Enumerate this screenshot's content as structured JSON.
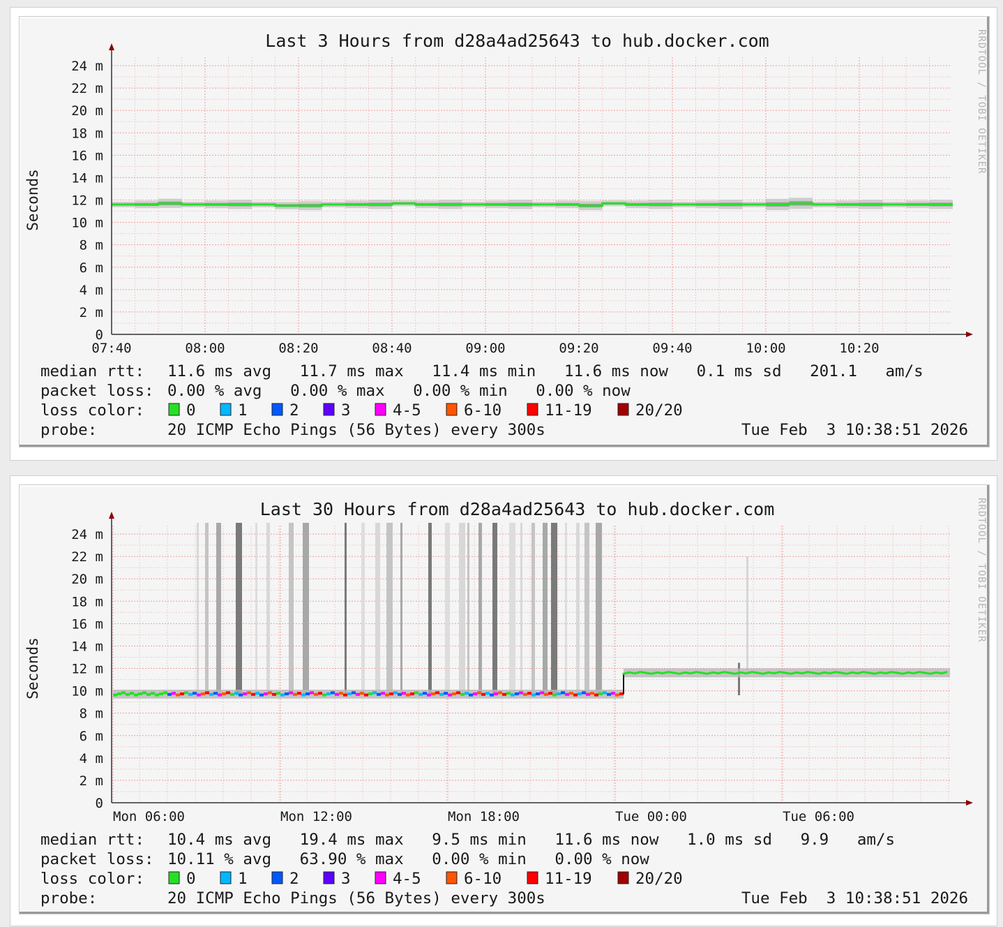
{
  "graphs": [
    {
      "title": "Last 3 Hours from d28a4ad25643 to hub.docker.com",
      "ylabel": "Seconds",
      "vertical_credit": "RRDTOOL / TOBI OETIKER",
      "stats": {
        "median_label": "median rtt:",
        "median_line": "11.6 ms avg   11.7 ms max   11.4 ms min   11.6 ms now   0.1 ms sd   201.1   am/s",
        "loss_label": "packet loss:",
        "loss_line": "0.00 % avg   0.00 % max   0.00 % min   0.00 % now",
        "color_label": "loss color:",
        "probe_label": "probe:",
        "probe_line": "20 ICMP Echo Pings (56 Bytes) every 300s",
        "timestamp": "Tue Feb  3 10:38:51 2026"
      }
    },
    {
      "title": "Last 30 Hours from d28a4ad25643 to hub.docker.com",
      "ylabel": "Seconds",
      "vertical_credit": "RRDTOOL / TOBI OETIKER",
      "stats": {
        "median_label": "median rtt:",
        "median_line": "10.4 ms avg   19.4 ms max   9.5 ms min   11.6 ms now   1.0 ms sd   9.9   am/s",
        "loss_label": "packet loss:",
        "loss_line": "10.11 % avg   63.90 % max   0.00 % min   0.00 % now",
        "color_label": "loss color:",
        "probe_label": "probe:",
        "probe_line": "20 ICMP Echo Pings (56 Bytes) every 300s",
        "timestamp": "Tue Feb  3 10:38:51 2026"
      }
    }
  ],
  "loss_colors": [
    {
      "label": "0",
      "color": "#26e026"
    },
    {
      "label": "1",
      "color": "#00b8ff"
    },
    {
      "label": "2",
      "color": "#0059ff"
    },
    {
      "label": "3",
      "color": "#5e00ff"
    },
    {
      "label": "4-5",
      "color": "#ff00ff"
    },
    {
      "label": "6-10",
      "color": "#ff5500"
    },
    {
      "label": "11-19",
      "color": "#ff0000"
    },
    {
      "label": "20/20",
      "color": "#a10000"
    }
  ],
  "chart_data": [
    {
      "type": "line",
      "title": "Last 3 Hours from d28a4ad25643 to hub.docker.com",
      "ylabel": "Seconds",
      "y_unit": "ms",
      "ylim": [
        0,
        25
      ],
      "yticks": [
        "0",
        "2 m",
        "4 m",
        "6 m",
        "8 m",
        "10 m",
        "12 m",
        "14 m",
        "16 m",
        "18 m",
        "20 m",
        "22 m",
        "24 m"
      ],
      "xticks": [
        "07:40",
        "08:00",
        "08:20",
        "08:40",
        "09:00",
        "09:20",
        "09:40",
        "10:00",
        "10:20"
      ],
      "x_range_minutes": [
        0,
        180
      ],
      "grid": true,
      "series": [
        {
          "name": "median rtt",
          "x_minutes": [
            0,
            5,
            10,
            15,
            20,
            25,
            30,
            35,
            40,
            45,
            50,
            55,
            60,
            65,
            70,
            75,
            80,
            85,
            90,
            95,
            100,
            105,
            110,
            115,
            120,
            125,
            130,
            135,
            140,
            145,
            150,
            155,
            160,
            165,
            170,
            175
          ],
          "y_ms": [
            11.6,
            11.6,
            11.7,
            11.6,
            11.6,
            11.6,
            11.6,
            11.5,
            11.5,
            11.6,
            11.6,
            11.6,
            11.7,
            11.6,
            11.6,
            11.6,
            11.6,
            11.6,
            11.6,
            11.6,
            11.5,
            11.7,
            11.6,
            11.6,
            11.6,
            11.6,
            11.6,
            11.6,
            11.6,
            11.7,
            11.6,
            11.6,
            11.6,
            11.6,
            11.6,
            11.6
          ],
          "loss_pct": [
            0
          ]
        }
      ]
    },
    {
      "type": "line",
      "title": "Last 30 Hours from d28a4ad25643 to hub.docker.com",
      "ylabel": "Seconds",
      "y_unit": "ms",
      "ylim": [
        0,
        25
      ],
      "yticks": [
        "0",
        "2 m",
        "4 m",
        "6 m",
        "8 m",
        "10 m",
        "12 m",
        "14 m",
        "16 m",
        "18 m",
        "20 m",
        "22 m",
        "24 m"
      ],
      "xticks": [
        "Mon 06:00",
        "Mon 12:00",
        "Mon 18:00",
        "Tue 00:00",
        "Tue 06:00"
      ],
      "x_range_hours": [
        0,
        30
      ],
      "grid": true,
      "series": [
        {
          "name": "median rtt",
          "segments": [
            {
              "x_hours": [
                0,
                18.3
              ],
              "y_ms": 9.7,
              "loss": "mixed 0 / 1 / 2 / 4-5 / 6-10 / 11-19"
            },
            {
              "x_hours": [
                18.3,
                30
              ],
              "y_ms": 11.6,
              "loss": "0"
            }
          ],
          "high_rtt_spikes_x_hours": [
            3.0,
            3.3,
            3.7,
            4.4,
            5.1,
            5.5,
            6.3,
            6.8,
            8.3,
            8.9,
            9.4,
            9.8,
            10.3,
            11.3,
            11.9,
            12.4,
            12.7,
            13.1,
            13.6,
            14.2,
            14.6,
            15.0,
            15.4,
            15.7,
            16.2,
            16.6,
            16.9,
            17.3,
            22.4
          ]
        }
      ]
    }
  ]
}
